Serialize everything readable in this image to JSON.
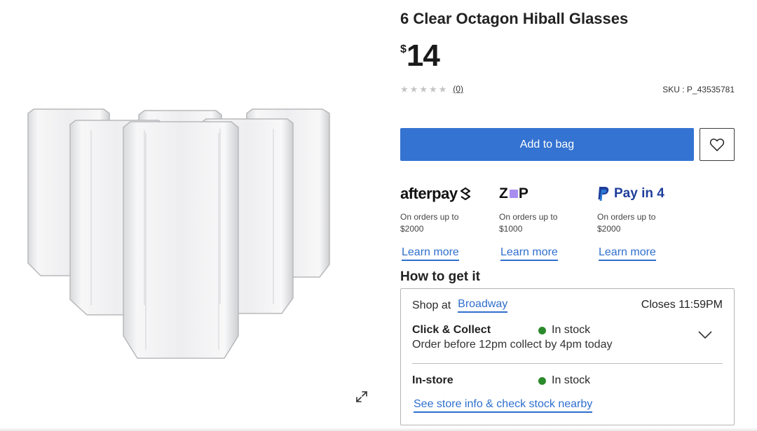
{
  "product": {
    "title": "6 Clear Octagon Hiball Glasses",
    "price_currency": "$",
    "price_amount": "14",
    "rating_stars": 0,
    "review_count": "(0)",
    "sku": "SKU : P_43535781"
  },
  "actions": {
    "add_to_bag": "Add to bag"
  },
  "payments": [
    {
      "name": "afterpay",
      "line1": "On orders up to",
      "line2": "$2000",
      "link": "Learn more"
    },
    {
      "name": "zip",
      "line1": "On orders up to",
      "line2": "$1000",
      "link": "Learn more"
    },
    {
      "name": "Pay in 4",
      "line1": "On orders up to",
      "line2": "$2000",
      "link": "Learn more"
    }
  ],
  "fulfilment": {
    "heading": "How to get it",
    "shop_at_label": "Shop at",
    "store_name": "Broadway",
    "closes": "Closes 11:59PM",
    "click_collect_label": "Click & Collect",
    "click_collect_status": "In stock",
    "click_collect_note": "Order before 12pm collect by 4pm today",
    "instore_label": "In-store",
    "instore_status": "In stock",
    "store_info_link": "See store info & check stock nearby"
  },
  "colors": {
    "primary_button": "#3473d1",
    "link": "#2f6fce",
    "in_stock": "#2b8a2b",
    "paypal": "#1f3e9b",
    "zip_accent": "#a98ef0"
  },
  "icons": [
    "expand-icon",
    "heart-icon",
    "star-icon",
    "chevron-down-icon",
    "afterpay-logo",
    "zip-logo",
    "paypal-icon"
  ]
}
